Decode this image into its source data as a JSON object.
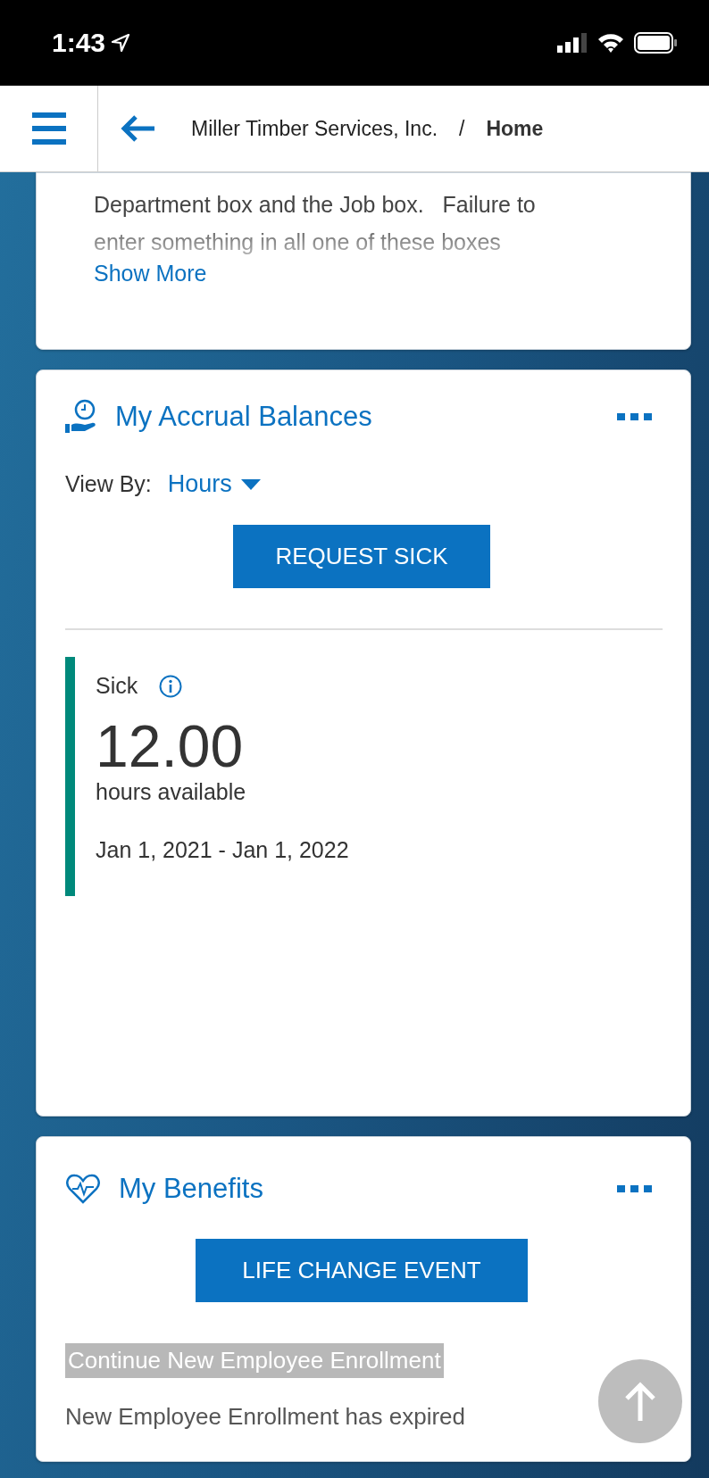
{
  "status_bar": {
    "time": "1:43"
  },
  "header": {
    "breadcrumb": [
      {
        "label": "Miller Timber Services, Inc.",
        "current": false
      },
      {
        "label": "Home",
        "current": true
      }
    ],
    "separator": "/"
  },
  "notice_card": {
    "text": "Department box and the Job box.   Failure to\nenter something in all one of these boxes",
    "link": "Show More"
  },
  "accrual_card": {
    "title": "My Accrual Balances",
    "view_by_label": "View By:",
    "view_by_value": "Hours",
    "button": "REQUEST SICK",
    "balances": [
      {
        "name": "Sick",
        "amount": "12.00",
        "unit": "hours available",
        "period": "Jan 1, 2021 - Jan 1, 2022",
        "color": "#00897b"
      }
    ]
  },
  "benefits_card": {
    "title": "My Benefits",
    "button": "LIFE CHANGE EVENT",
    "link": "Continue New Employee Enrollment",
    "status": "New Employee Enrollment has expired"
  }
}
